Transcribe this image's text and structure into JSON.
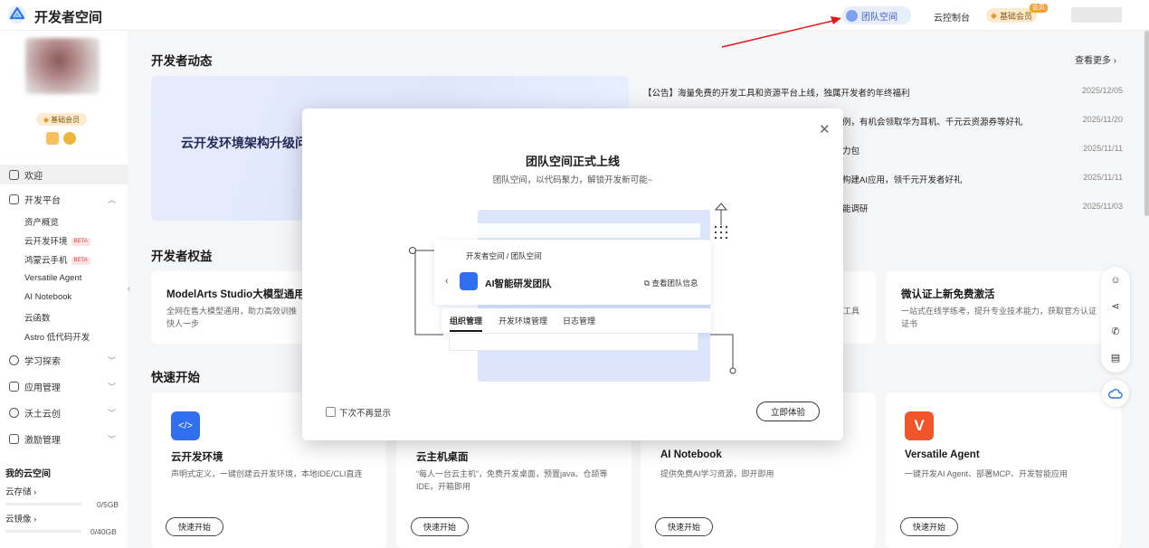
{
  "header": {
    "brand": "开发者空间",
    "team_space": "团队空间",
    "console": "云控制台",
    "vip": "基础会员",
    "vip_badge": "会员"
  },
  "sidebar": {
    "vip": "基础会员",
    "items": [
      {
        "label": "欢迎",
        "icon": "home-icon"
      },
      {
        "label": "开发平台",
        "icon": "platform-icon"
      },
      {
        "label": "学习探索",
        "icon": "learn-icon"
      },
      {
        "label": "应用管理",
        "icon": "app-icon"
      },
      {
        "label": "沃土云创",
        "icon": "cloud-icon"
      },
      {
        "label": "激励管理",
        "icon": "gift-icon"
      }
    ],
    "sub_items": [
      {
        "label": "资产概览"
      },
      {
        "label": "云开发环境",
        "badge": "BETA"
      },
      {
        "label": "鸿蒙云手机",
        "badge": "BETA"
      },
      {
        "label": "Versatile Agent"
      },
      {
        "label": "AI Notebook"
      },
      {
        "label": "云函数"
      },
      {
        "label": "Astro 低代码开发"
      }
    ],
    "my_cloud": "我的云空间",
    "storage": [
      {
        "label": "云存储",
        "value": "0/5GB"
      },
      {
        "label": "云镜像",
        "value": "0/40GB"
      }
    ]
  },
  "main": {
    "news_title": "开发者动态",
    "more": "查看更多",
    "banner_text": "云开发环境架构升级问卷",
    "news": [
      {
        "text": "【公告】海量免费的开发工具和资源平台上线，独属开发者的年终福利",
        "date": "2025/12/05"
      },
      {
        "text": "例，有机会领取华为耳机、千元云资源券等好礼",
        "date": "2025/11/20"
      },
      {
        "text": "力包",
        "date": "2025/11/11"
      },
      {
        "text": "构建AI应用，领千元开发者好礼",
        "date": "2025/11/11"
      },
      {
        "text": "能调研",
        "date": "2025/11/03"
      }
    ],
    "rights_title": "开发者权益",
    "rights": [
      {
        "title": "ModelArts Studio大模型通用代",
        "desc1": "全网在售大模型通用，助力高效训推",
        "desc2": "快人一步"
      },
      {
        "title": "",
        "desc1": "工具",
        "desc2": ""
      },
      {
        "title": "微认证上新免费激活",
        "desc1": "一站式在线学练考，提升专业技术能力，获取官方认证",
        "desc2": "证书"
      }
    ],
    "quick_title": "快速开始",
    "quick": [
      {
        "title": "云开发环境",
        "desc": "声明式定义，一键创建云开发环境，本地IDE/CLI直连",
        "btn": "快速开始"
      },
      {
        "title": "云主机桌面",
        "desc": "“每人一台云主机”，免费开发桌面，预置java、仓颉等IDE，开箱即用",
        "btn": "快速开始"
      },
      {
        "title": "AI Notebook",
        "desc": "提供免费AI学习资源，即开即用",
        "btn": "快速开始"
      },
      {
        "title": "Versatile Agent",
        "desc": "一键开发AI Agent、部署MCP、开发智能应用",
        "btn": "快速开始"
      }
    ]
  },
  "modal": {
    "title": "团队空间正式上线",
    "subtitle": "团队空间，以代码聚力，解锁开发新可能~",
    "breadcrumb": "开发者空间 / 团队空间",
    "team_name": "AI智能研发团队",
    "team_info": "查看团队信息",
    "tabs": [
      "组织管理",
      "开发环境管理",
      "日志管理"
    ],
    "dont_show": "下次不再显示",
    "try_now": "立即体验"
  },
  "colors": {
    "accent": "#2f6ff0",
    "arrow": "#e01818",
    "vip": "#fbead0"
  }
}
